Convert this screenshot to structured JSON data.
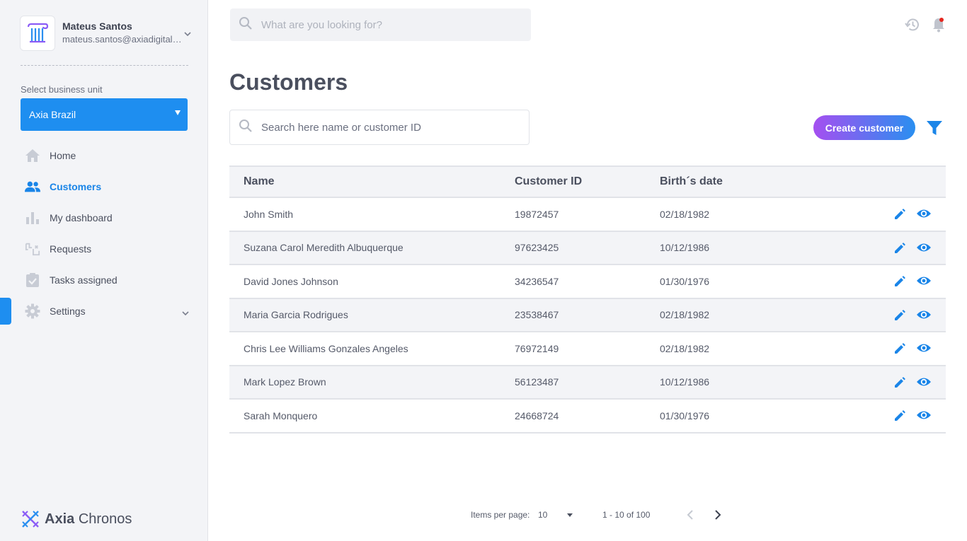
{
  "user": {
    "name": "Mateus Santos",
    "email": "mateus.santos@axiadigital.com"
  },
  "business_unit": {
    "label": "Select business unit",
    "selected": "Axia Brazil"
  },
  "nav": {
    "items": [
      {
        "label": "Home",
        "icon": "home-icon"
      },
      {
        "label": "Customers",
        "icon": "users-icon",
        "active": true
      },
      {
        "label": "My dashboard",
        "icon": "bar-chart-icon"
      },
      {
        "label": "Requests",
        "icon": "requests-icon"
      },
      {
        "label": "Tasks assigned",
        "icon": "clipboard-check-icon"
      },
      {
        "label": "Settings",
        "icon": "gear-icon"
      }
    ]
  },
  "brand": {
    "name_strong": "Axia",
    "name_light": "Chronos"
  },
  "top_search": {
    "placeholder": "What are you looking for?"
  },
  "page": {
    "title": "Customers",
    "search_placeholder": "Search here name or customer ID",
    "create_label": "Create customer"
  },
  "table": {
    "headers": {
      "name": "Name",
      "customer_id": "Customer ID",
      "birth_date": "Birth´s date"
    },
    "rows": [
      {
        "name": "John Smith",
        "id": "19872457",
        "birth": "02/18/1982"
      },
      {
        "name": "Suzana Carol Meredith Albuquerque",
        "id": "97623425",
        "birth": "10/12/1986"
      },
      {
        "name": "David Jones Johnson",
        "id": "34236547",
        "birth": "01/30/1976"
      },
      {
        "name": "Maria Garcia Rodrigues",
        "id": "23538467",
        "birth": "02/18/1982"
      },
      {
        "name": "Chris Lee Williams Gonzales Angeles",
        "id": "76972149",
        "birth": "02/18/1982"
      },
      {
        "name": "Mark Lopez Brown",
        "id": "56123487",
        "birth": "10/12/1986"
      },
      {
        "name": "Sarah Monquero",
        "id": "24668724",
        "birth": "01/30/1976"
      }
    ]
  },
  "pagination": {
    "items_per_page_label": "Items per page:",
    "items_per_page": "10",
    "range": "1 - 10 of 100"
  },
  "colors": {
    "accent": "#1e8ef0",
    "gradient_start": "#a54ff0",
    "gradient_end": "#2a8ff0",
    "notification_dot": "#e5261e"
  }
}
